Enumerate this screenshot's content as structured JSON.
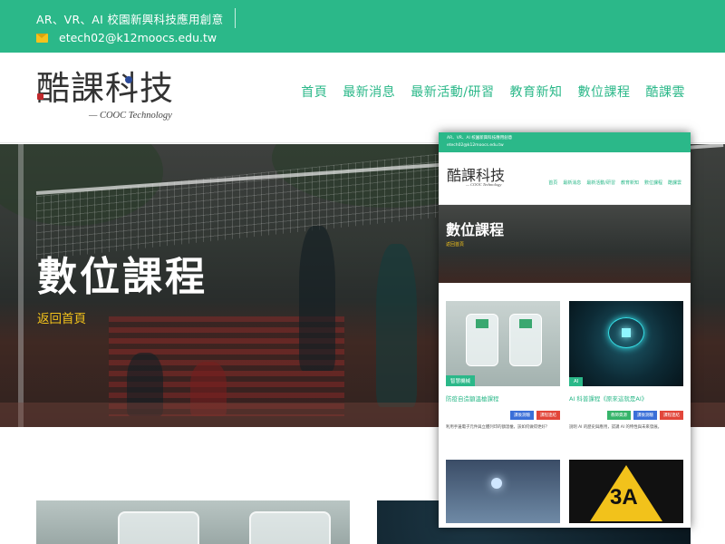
{
  "topbar": {
    "tagline": "AR、VR、AI 校園新興科技應用創意",
    "email": "etech02@k12moocs.edu.tw"
  },
  "header": {
    "logo_text": "酷課科技",
    "logo_sub": "— COOC Technology",
    "nav": [
      "首頁",
      "最新消息",
      "最新活動/研習",
      "教育新知",
      "數位課程",
      "酷課雲"
    ]
  },
  "hero": {
    "title": "數位課程",
    "back_link": "返回首頁"
  },
  "preview": {
    "topbar": {
      "tagline": "AR、VR、AI 校園新興科技應用創意",
      "email": "etech02@k12moocs.edu.tw"
    },
    "logo_text": "酷課科技",
    "logo_sub": "— COOC Technology",
    "nav": [
      "首頁",
      "最新消息",
      "最新活動/研習",
      "教育新知",
      "數位課程",
      "酷課雲"
    ],
    "hero_title": "數位課程",
    "hero_back": "返回首頁",
    "cards": [
      {
        "badge": "智慧機械",
        "title": "防疫自造額溫槍課程",
        "buttons": [
          "課後測驗",
          "課程連結"
        ],
        "desc": "利用手邊電子元件與立體列印的額溫槍，該如何做得更好？"
      },
      {
        "badge": "AI",
        "title": "AI 科普課程《原來這就是AI》",
        "buttons": [
          "教師資源",
          "課後測驗",
          "課程連結"
        ],
        "desc": "說明 AI 的歷史與應用，認識 AI 的特性與未來發展。"
      }
    ],
    "card4_text": "3A"
  },
  "colors": {
    "accent": "#2bb889",
    "highlight": "#f2c21b",
    "btn_blue": "#3b6fd8",
    "btn_red": "#e2463a",
    "btn_green": "#36b46a"
  }
}
